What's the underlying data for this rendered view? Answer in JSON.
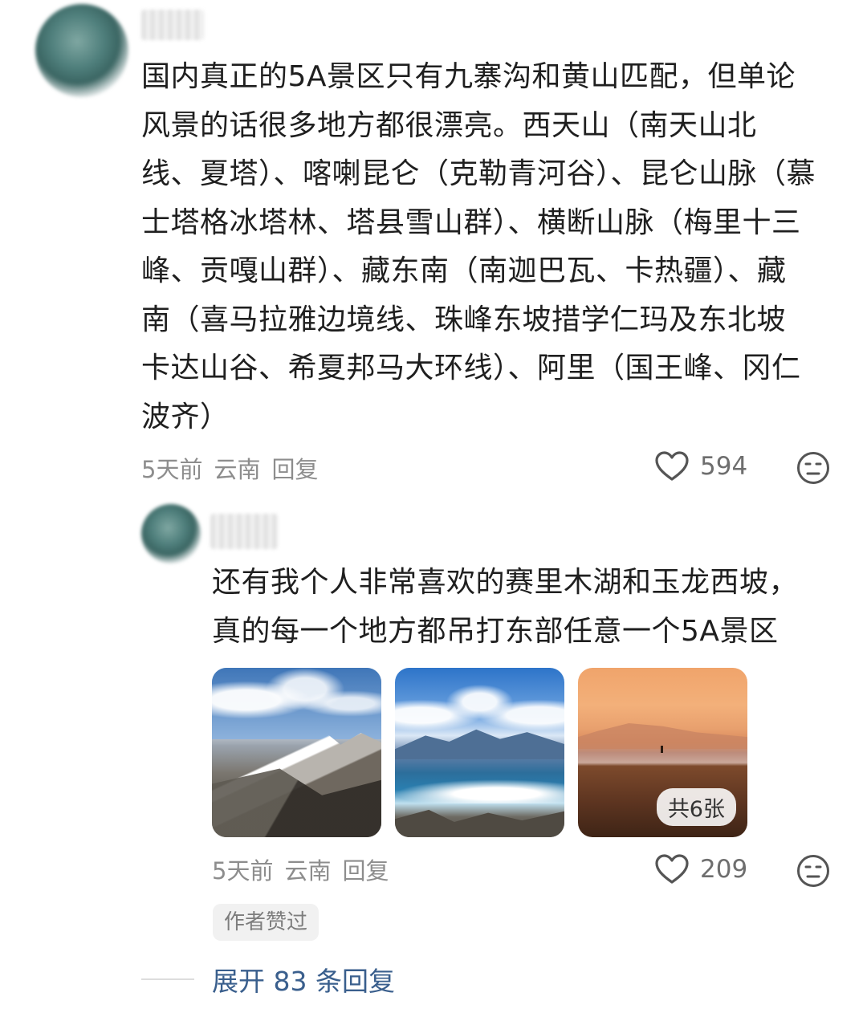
{
  "comments": [
    {
      "lines": [
        "国内真正的5A景区只有九寨沟和黄山匹配，但单论",
        "风景的话很多地方都很漂亮。西天山（南天山北",
        "线、夏塔）、喀喇昆仑（克勒青河谷）、昆仑山脉（慕",
        "士塔格冰塔林、塔县雪山群）、横断山脉（梅里十三",
        "峰、贡嘎山群）、藏东南（南迦巴瓦、卡热疆）、藏",
        "南（喜马拉雅边境线、珠峰东坡措学仁玛及东北坡",
        "卡达山谷、希夏邦马大环线）、阿里（国王峰、冈仁",
        "波齐）"
      ],
      "time": "5天前",
      "location": "云南",
      "reply_label": "回复",
      "likes": "594"
    },
    {
      "lines": [
        "还有我个人非常喜欢的赛里木湖和玉龙西坡，",
        "真的每一个地方都吊打东部任意一个5A景区"
      ],
      "time": "5天前",
      "location": "云南",
      "reply_label": "回复",
      "likes": "209",
      "image_count": "共6张",
      "badge": "作者赞过"
    }
  ],
  "expand_label": "展开 83 条回复",
  "icons": [
    "heart-icon",
    "emoji-icon"
  ],
  "colors": {
    "link": "#3a5f8d",
    "meta": "#8d8d8d"
  }
}
